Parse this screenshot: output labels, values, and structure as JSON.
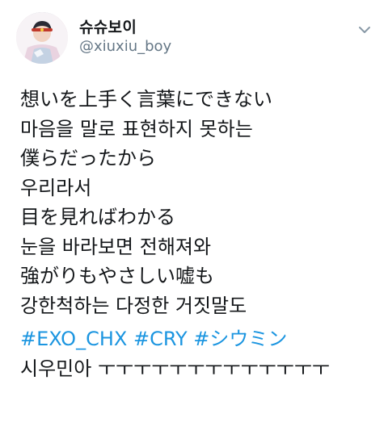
{
  "tweet": {
    "author": {
      "display_name": "슈슈보이",
      "handle": "@xiuxiu_boy"
    },
    "menu_icon": "chevron-down-icon",
    "lines": [
      "想いを上手く言葉にできない",
      "마음을 말로 표현하지 못하는",
      "僕らだったから",
      "우리라서",
      "目を見ればわかる",
      "눈을 바라보면 전해져와",
      "強がりもやさしい嘘も",
      "강한척하는 다정한 거짓말도"
    ],
    "hashtags": [
      "#EXO_CHX",
      "#CRY",
      "#シウミン"
    ],
    "last_line": "시우민아 ㅜㅜㅜㅜㅜㅜㅜㅜㅜㅜㅜㅜㅜ"
  },
  "colors": {
    "text": "#14171a",
    "secondary": "#657786",
    "link": "#1b95e0"
  }
}
